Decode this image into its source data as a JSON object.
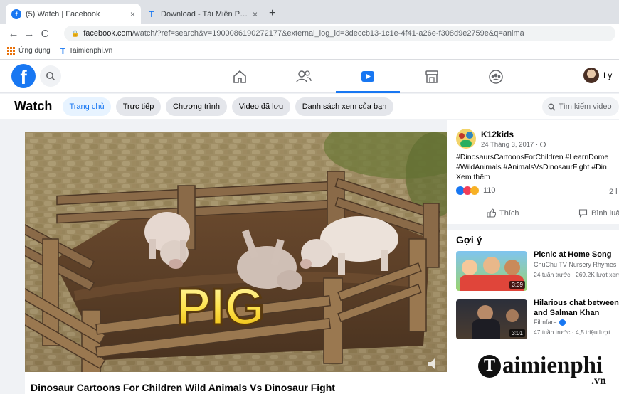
{
  "browser": {
    "tabs": [
      {
        "title": "(5) Watch | Facebook",
        "icon": "facebook-icon",
        "active": true
      },
      {
        "title": "Download - Tải Miễn Phí VN - Ph",
        "icon": "taimienphi-icon",
        "active": false
      }
    ],
    "close_glyph": "×",
    "new_tab_glyph": "+",
    "url": {
      "host": "facebook.com",
      "path": "/watch/?ref=search&v=1900086190272177&external_log_id=3deccb13-1c1e-4f41-a26e-f308d9e2759e&q=anima"
    },
    "bookmarks": [
      {
        "label": "Ứng dụng",
        "icon": "apps-grid-icon"
      },
      {
        "label": "Taimienphi.vn",
        "icon": "taimienphi-icon"
      }
    ]
  },
  "facebook": {
    "logo_letter": "f",
    "nav": [
      {
        "icon": "home-icon",
        "active": false
      },
      {
        "icon": "friends-icon",
        "active": false
      },
      {
        "icon": "watch-icon",
        "active": true
      },
      {
        "icon": "marketplace-icon",
        "active": false
      },
      {
        "icon": "groups-icon",
        "active": false
      }
    ],
    "profile_name": "Ly",
    "watch": {
      "title": "Watch",
      "tabs": [
        "Trang chủ",
        "Trực tiếp",
        "Chương trình",
        "Video đã lưu",
        "Danh sách xem của bạn"
      ],
      "active_tab": "Trang chủ",
      "search_placeholder": "Tìm kiếm video"
    }
  },
  "video": {
    "overlay_text": "PIG",
    "title_below": "Dinosaur Cartoons For Children Wild Animals Vs Dinosaur Fight"
  },
  "post": {
    "author": "K12kids",
    "date": "24 Tháng 3, 2017 ·",
    "hashtags_line1": "#DinosaursCartoonsForChildren #LearnDome",
    "hashtags_line2": "#WildAnimals #AnimalsVsDinosaurFight #Din",
    "see_more": "Xem thêm",
    "reactions_count": "110",
    "shares_short": "2 l",
    "like_label": "Thích",
    "comment_label": "Bình luận"
  },
  "suggestions": {
    "heading": "Gợi ý",
    "items": [
      {
        "title": "Picnic at Home Song",
        "channel": "ChuChu TV Nursery Rhymes",
        "meta": "24 tuần trước · 269,2K lượt xem",
        "duration": "3:39"
      },
      {
        "title_line1": "Hilarious chat between",
        "title_line2": "and Salman Khan",
        "channel": "Filmfare",
        "meta": "47 tuần trước · 4,5 triệu lượt",
        "duration": "3:01"
      }
    ]
  },
  "watermark": {
    "main": "aimienphi",
    "suffix": ".vn",
    "initial": "T"
  },
  "colors": {
    "fb_blue": "#1877f2",
    "chrome_tabbar": "#dee1e6"
  }
}
